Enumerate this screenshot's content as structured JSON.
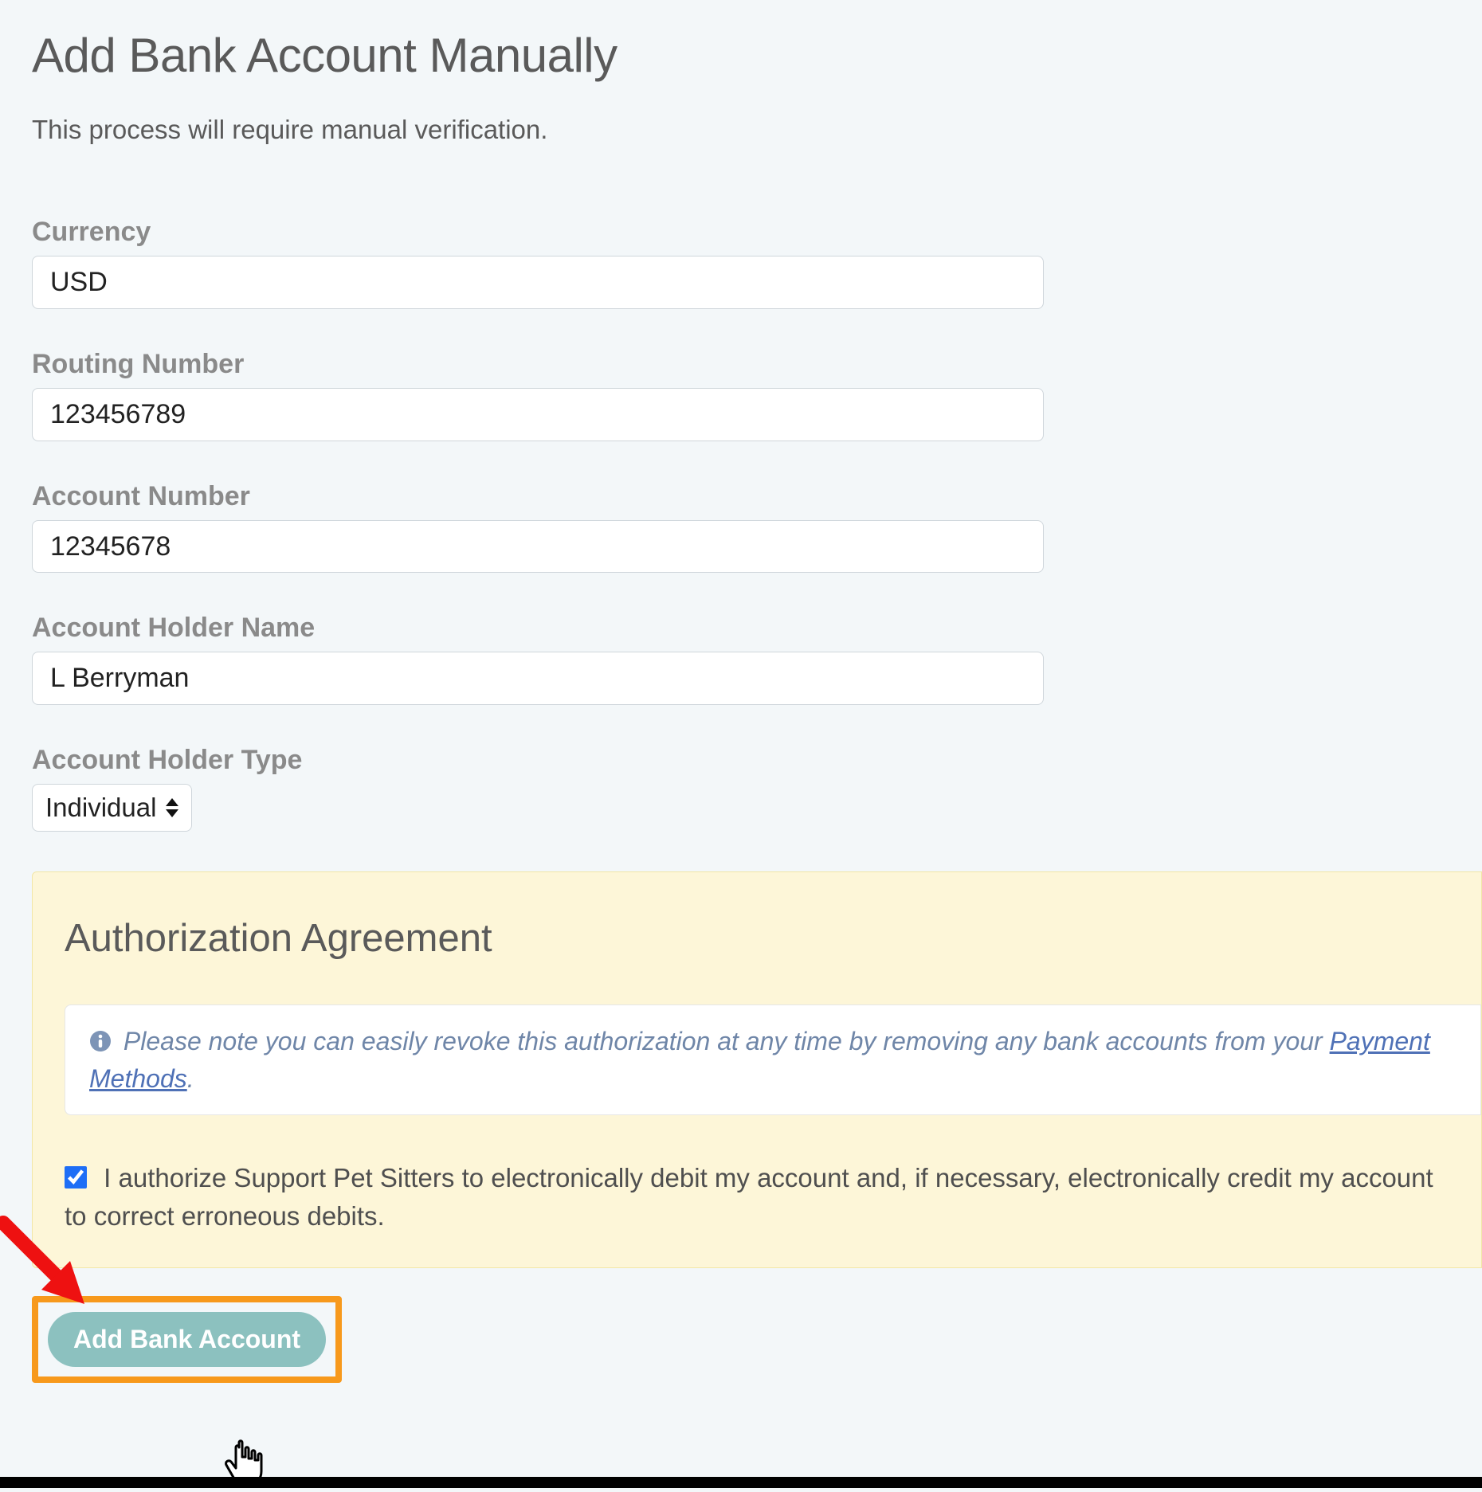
{
  "page": {
    "title": "Add Bank Account Manually",
    "subtitle": "This process will require manual verification."
  },
  "form": {
    "currency": {
      "label": "Currency",
      "value": "USD"
    },
    "routing": {
      "label": "Routing Number",
      "value": "123456789"
    },
    "account": {
      "label": "Account Number",
      "value": "12345678"
    },
    "holder_name": {
      "label": "Account Holder Name",
      "value": "L Berryman"
    },
    "holder_type": {
      "label": "Account Holder Type",
      "selected": "Individual"
    }
  },
  "authorization": {
    "title": "Authorization Agreement",
    "note_prefix": "Please note you can easily revoke this authorization at any time by removing any bank accounts from your ",
    "note_link": "Payment Methods",
    "note_suffix": ".",
    "checkbox_checked": true,
    "checkbox_text": "I authorize Support Pet Sitters to electronically debit my account and, if necessary, electronically credit my account to correct erroneous debits."
  },
  "submit": {
    "label": "Add Bank Account"
  },
  "icons": {
    "info": "info-icon",
    "sort": "sort-icon",
    "cursor": "pointer-cursor-icon",
    "arrow": "red-arrow-icon"
  }
}
